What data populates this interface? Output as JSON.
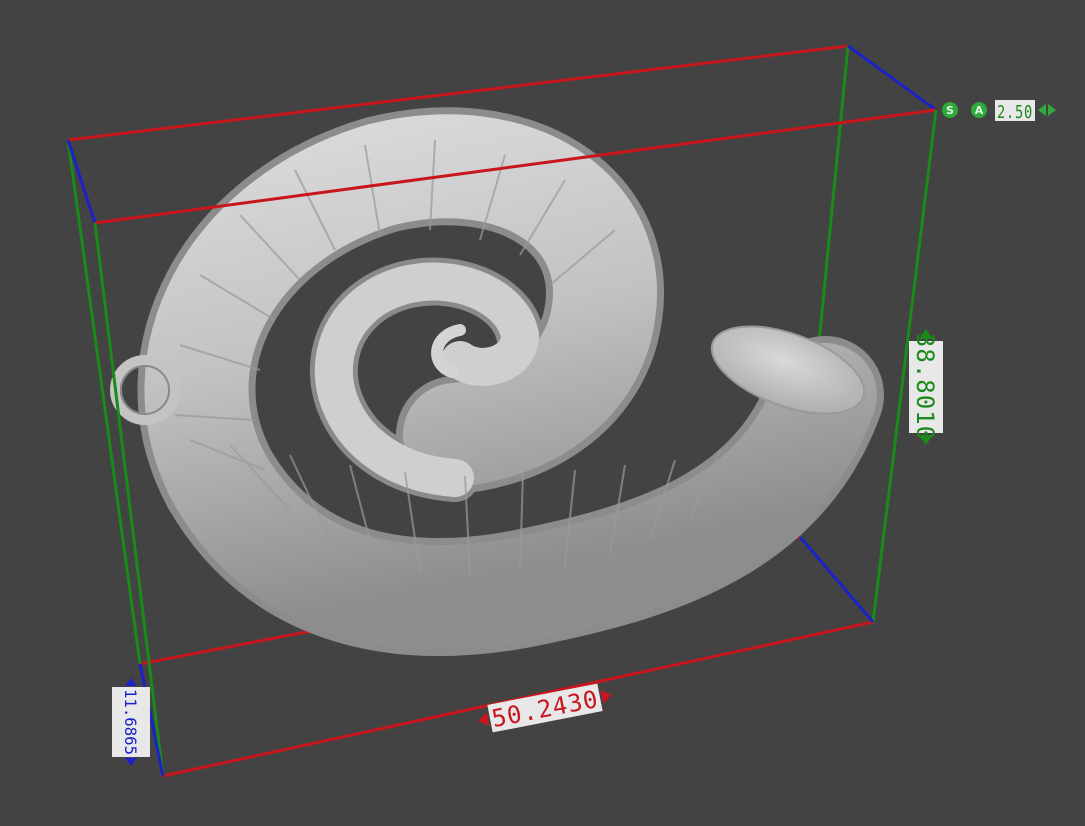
{
  "toolbar": {
    "snap_label": "S",
    "angle_label": "A",
    "step_value": "2.50"
  },
  "dimensions": {
    "length": "50.2430",
    "height": "38.8010",
    "depth": "11.6865"
  },
  "colors": {
    "background": "#434343",
    "x_axis": "#c8161c",
    "y_axis": "#1a8a1a",
    "z_axis": "#1a22c8",
    "model": "#c9c9c9",
    "label_bg": "#e8e8e8"
  },
  "icons": {
    "snap": "snap-toggle-icon",
    "angle": "angle-toggle-icon",
    "step_arrows": "step-arrows-icon"
  }
}
